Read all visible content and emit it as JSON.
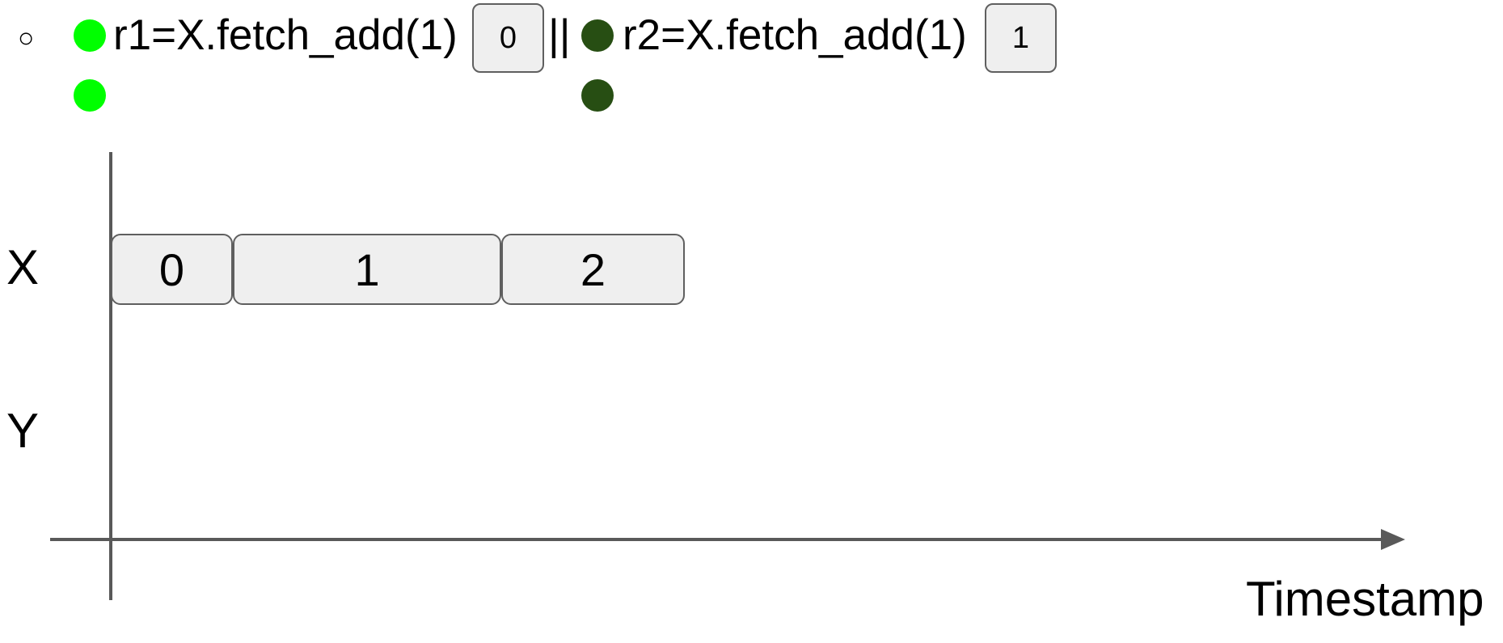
{
  "colors": {
    "thread1_dot": "#00ff00",
    "thread2_dot": "#274e13",
    "box_fill": "#efefef",
    "box_border": "#5f5f5f",
    "axis": "#595959"
  },
  "header": {
    "bullet": "○",
    "thread1": {
      "code": "r1=X.fetch_add(1)",
      "result": "0"
    },
    "separator": "||",
    "thread2": {
      "code": "r2=X.fetch_add(1)",
      "result": "1"
    }
  },
  "rows": {
    "x_label": "X",
    "y_label": "Y"
  },
  "timeline": {
    "x_segments": [
      {
        "value": "0",
        "start": 0,
        "end": 1
      },
      {
        "value": "1",
        "start": 1,
        "end": 3.2
      },
      {
        "value": "2",
        "start": 3.2,
        "end": 4.7
      }
    ]
  },
  "axis": {
    "x_label": "Timestamp"
  }
}
